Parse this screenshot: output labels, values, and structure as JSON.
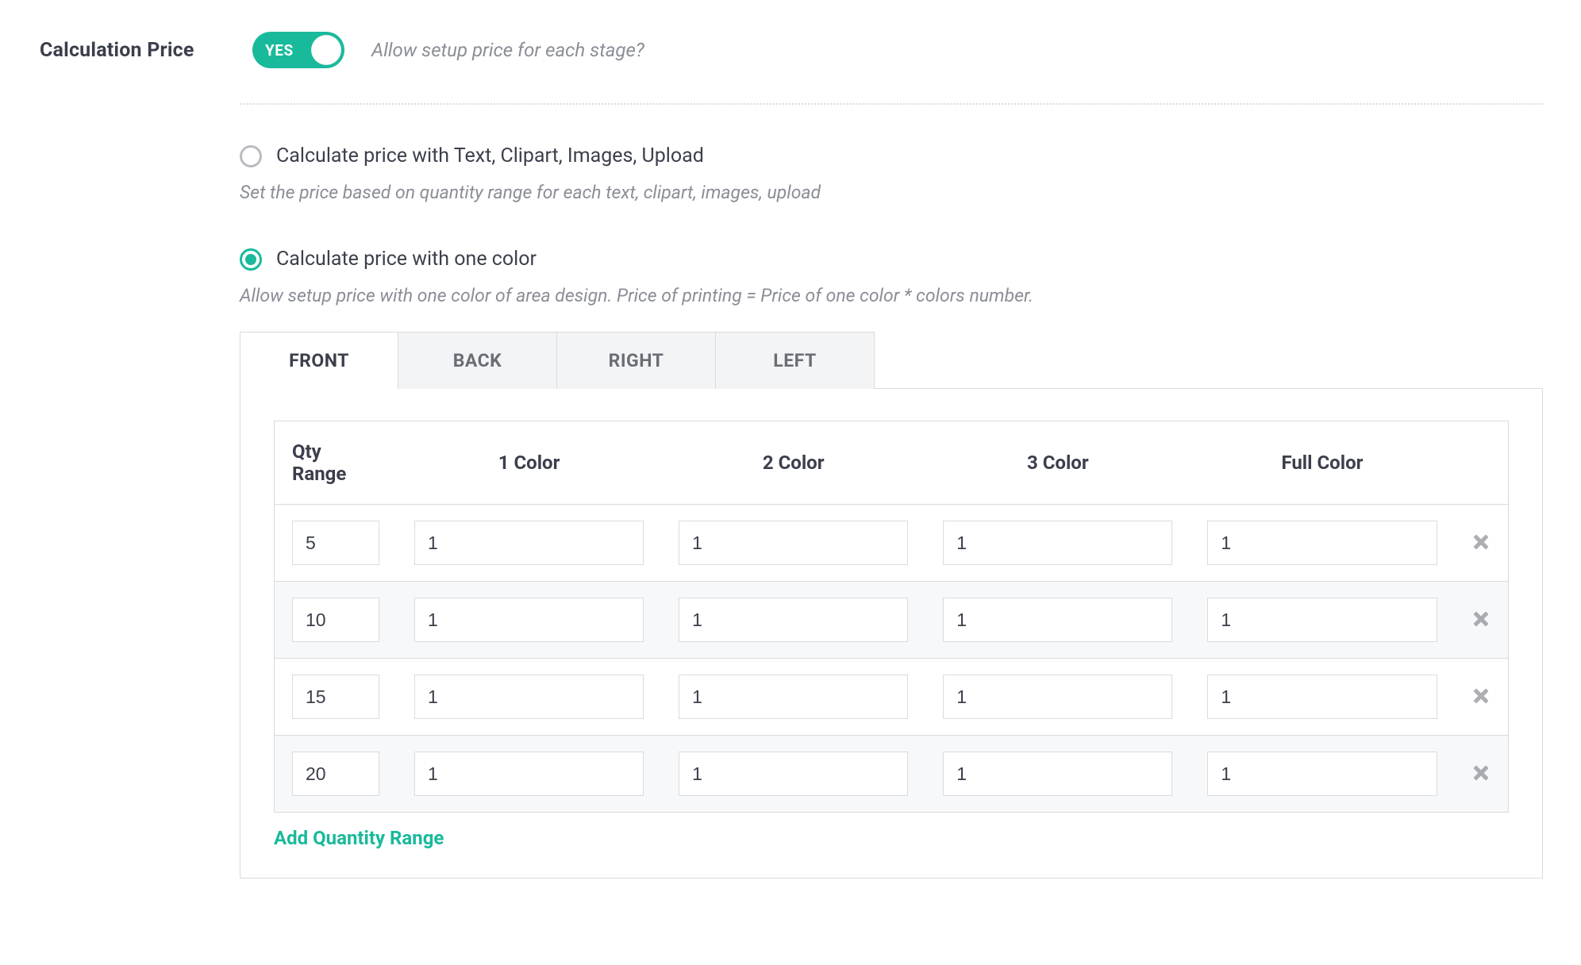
{
  "section_label": "Calculation Price",
  "toggle": {
    "state_label": "YES",
    "on": true,
    "help": "Allow setup price for each stage?"
  },
  "options": {
    "text_clipart": {
      "label": "Calculate price with Text, Clipart, Images, Upload",
      "hint": "Set the price based on quantity range for each text, clipart, images, upload",
      "selected": false
    },
    "one_color": {
      "label": "Calculate price with one color",
      "hint": "Allow setup price with one color of area design. Price of printing = Price of one color * colors number.",
      "selected": true
    }
  },
  "tabs": [
    {
      "label": "FRONT",
      "active": true
    },
    {
      "label": "BACK",
      "active": false
    },
    {
      "label": "RIGHT",
      "active": false
    },
    {
      "label": "LEFT",
      "active": false
    }
  ],
  "table": {
    "headers": {
      "qty": "Qty Range",
      "c1": "1 Color",
      "c2": "2 Color",
      "c3": "3 Color",
      "full": "Full Color"
    },
    "rows": [
      {
        "qty": "5",
        "c1": "1",
        "c2": "1",
        "c3": "1",
        "full": "1"
      },
      {
        "qty": "10",
        "c1": "1",
        "c2": "1",
        "c3": "1",
        "full": "1"
      },
      {
        "qty": "15",
        "c1": "1",
        "c2": "1",
        "c3": "1",
        "full": "1"
      },
      {
        "qty": "20",
        "c1": "1",
        "c2": "1",
        "c3": "1",
        "full": "1"
      }
    ]
  },
  "add_link": "Add Quantity Range"
}
